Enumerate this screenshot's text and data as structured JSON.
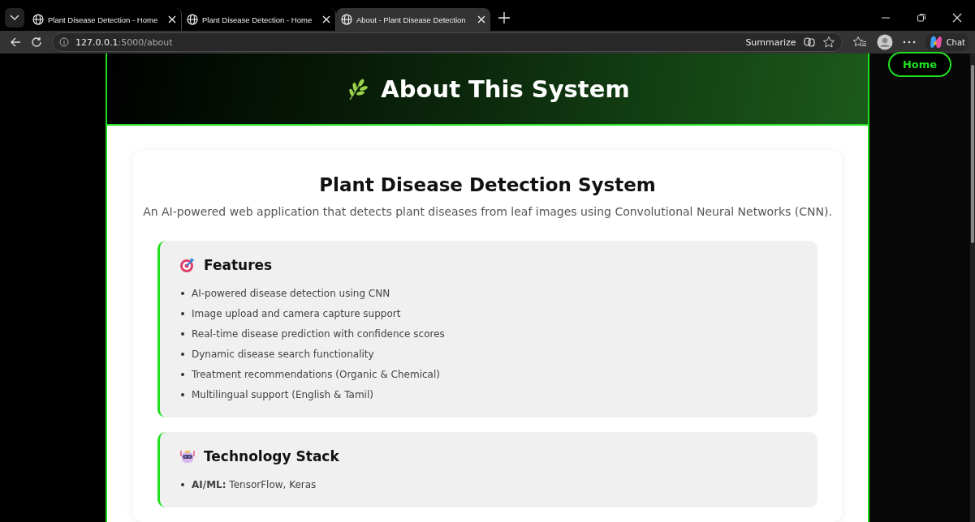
{
  "browser": {
    "tabs": [
      {
        "title": "Plant Disease Detection - Home",
        "selected": false
      },
      {
        "title": "Plant Disease Detection - Home",
        "selected": false
      },
      {
        "title": "About - Plant Disease Detection",
        "selected": true
      }
    ],
    "address": {
      "host": "127.0.0.1",
      "path": ":5000/about"
    },
    "summarize": "Summarize",
    "chat": "Chat"
  },
  "nav": {
    "home": "Home"
  },
  "header": {
    "title": "About This System"
  },
  "card": {
    "title": "Plant Disease Detection System",
    "subtitle": "An AI-powered web application that detects plant diseases from leaf images using Convolutional Neural Networks (CNN).",
    "sections": [
      {
        "kind": "target",
        "title": "Features",
        "items": [
          "AI-powered disease detection using CNN",
          "Image upload and camera capture support",
          "Real-time disease prediction with confidence scores",
          "Dynamic disease search functionality",
          "Treatment recommendations (Organic & Chemical)",
          "Multilingual support (English & Tamil)"
        ]
      },
      {
        "kind": "robot",
        "title": "Technology Stack",
        "items": [
          "**AI/ML:** TensorFlow, Keras"
        ]
      }
    ]
  }
}
